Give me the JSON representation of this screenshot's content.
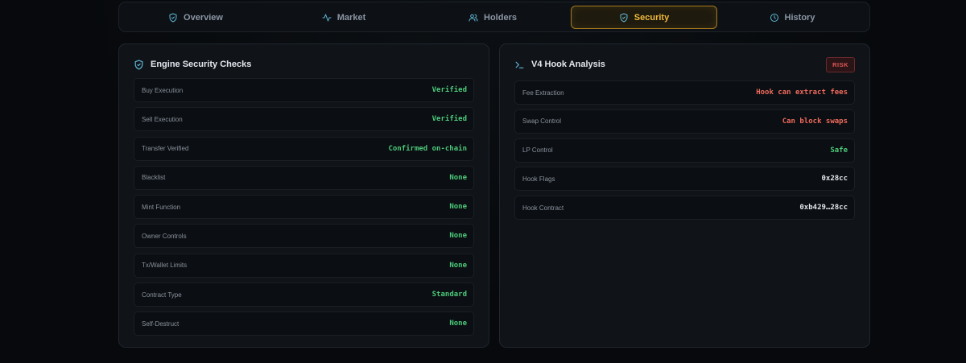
{
  "tabs": [
    {
      "key": "overview",
      "label": "Overview",
      "icon": "shield-icon"
    },
    {
      "key": "market",
      "label": "Market",
      "icon": "activity-icon"
    },
    {
      "key": "holders",
      "label": "Holders",
      "icon": "users-icon"
    },
    {
      "key": "security",
      "label": "Security",
      "icon": "shield-icon",
      "active": true
    },
    {
      "key": "history",
      "label": "History",
      "icon": "clock-icon"
    }
  ],
  "engine": {
    "title": "Engine Security Checks",
    "icon": "shield-check-icon",
    "rows": [
      {
        "label": "Buy Execution",
        "value": "Verified"
      },
      {
        "label": "Sell Execution",
        "value": "Verified"
      },
      {
        "label": "Transfer Verified",
        "value": "Confirmed on-chain"
      },
      {
        "label": "Blacklist",
        "value": "None"
      },
      {
        "label": "Mint Function",
        "value": "None"
      },
      {
        "label": "Owner Controls",
        "value": "None"
      },
      {
        "label": "Tx/Wallet Limits",
        "value": "None"
      },
      {
        "label": "Contract Type",
        "value": "Standard"
      },
      {
        "label": "Self-Destruct",
        "value": "None"
      }
    ]
  },
  "hook": {
    "title": "V4 Hook Analysis",
    "icon": "terminal-icon",
    "badge": "RISK",
    "rows": [
      {
        "label": "Fee Extraction",
        "value": "Hook can extract fees",
        "status": "danger"
      },
      {
        "label": "Swap Control",
        "value": "Can block swaps",
        "status": "danger"
      },
      {
        "label": "LP Control",
        "value": "Safe",
        "status": "ok"
      },
      {
        "label": "Hook Flags",
        "value": "0x28cc",
        "status": "plain"
      },
      {
        "label": "Hook Contract",
        "value": "0xb429…28cc",
        "status": "plain"
      }
    ]
  },
  "colors": {
    "accent": "#f0b93a",
    "ok": "#4cc97a",
    "danger": "#ef6a5c",
    "icon": "#5fb8d4"
  }
}
